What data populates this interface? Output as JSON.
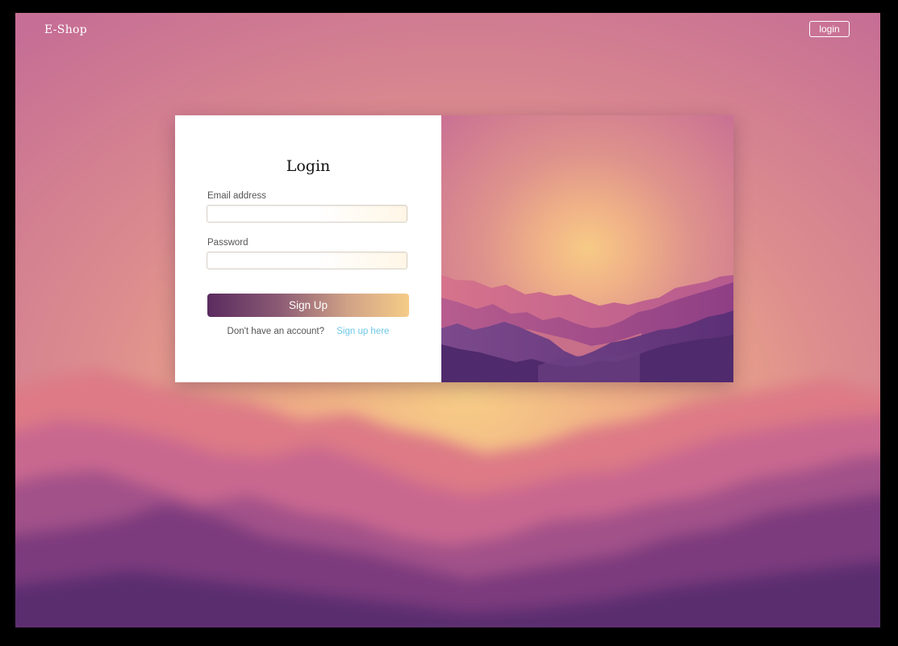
{
  "header": {
    "brand": "E-Shop",
    "login_button": "login"
  },
  "form": {
    "title": "Login",
    "email_label": "Email address",
    "email_value": "",
    "email_placeholder": "",
    "password_label": "Password",
    "password_value": "",
    "password_placeholder": "",
    "submit_label": "Sign Up",
    "account_prompt": "Don't have an account?",
    "signup_link": "Sign up here"
  },
  "colors": {
    "button_gradient_start": "#5a2b5e",
    "button_gradient_end": "#f5cc87",
    "link": "#6fc8e6",
    "sky_top": "#c86e94",
    "sun": "#f7c98a",
    "mountain_dark": "#4d2a6b"
  },
  "icons": {
    "illustration": "sunset-mountains-illustration",
    "background": "blurred-sunset-mountains-background"
  }
}
